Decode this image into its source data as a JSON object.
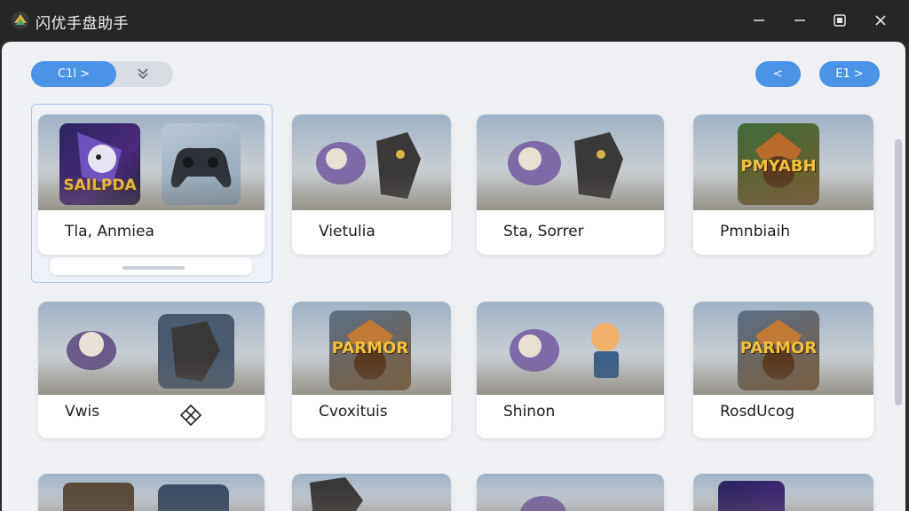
{
  "window": {
    "title": "闪优手盘助手"
  },
  "toolbar": {
    "left_pill": "C1l >",
    "left_icon": "chevrons-down-icon",
    "prev": "<",
    "next_pill": "E1 >"
  },
  "cards": [
    {
      "label": "Tla, Anmiea",
      "logo_text": "SAILPDA"
    },
    {
      "label": "Vietulia"
    },
    {
      "label": "Sta, Sorrer"
    },
    {
      "label": "Pmnbiaih",
      "logo_text": "PMYABH"
    },
    {
      "label": "Vwis"
    },
    {
      "label": "Cvoxituis",
      "logo_text": "PARMOR"
    },
    {
      "label": "Shinon"
    },
    {
      "label": "RosdUcog",
      "logo_text": "PARMOR"
    }
  ],
  "colors": {
    "accent": "#4a93e6",
    "titlebar": "#262626",
    "content_bg": "#eef0f3"
  }
}
